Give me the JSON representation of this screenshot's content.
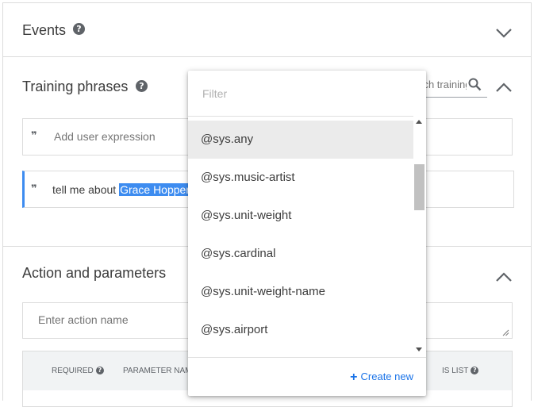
{
  "events": {
    "title": "Events"
  },
  "training_phrases": {
    "title": "Training phrases",
    "search_placeholder": "Search training phrases",
    "add_placeholder": "Add user expression",
    "phrase_prefix": "tell me about ",
    "phrase_highlight": "Grace Hopper"
  },
  "action": {
    "title": "Action and parameters",
    "name_placeholder": "Enter action name",
    "columns": {
      "required": "REQUIRED",
      "parameter_name": "PARAMETER NAME",
      "is_list": "IS LIST"
    }
  },
  "dropdown": {
    "filter_placeholder": "Filter",
    "items": [
      "@sys.any",
      "@sys.music-artist",
      "@sys.unit-weight",
      "@sys.cardinal",
      "@sys.unit-weight-name",
      "@sys.airport"
    ],
    "selected_index": 0,
    "create_new": "Create new"
  },
  "icons": {
    "help": "help-icon",
    "expand": "chevron-down-icon",
    "collapse": "chevron-up-icon",
    "search": "search-icon",
    "quote": "quote-icon",
    "plus": "plus-icon"
  },
  "colors": {
    "accent": "#1a73e8",
    "highlight": "#3d8cf0",
    "phrase_border": "#3d8cf0"
  }
}
